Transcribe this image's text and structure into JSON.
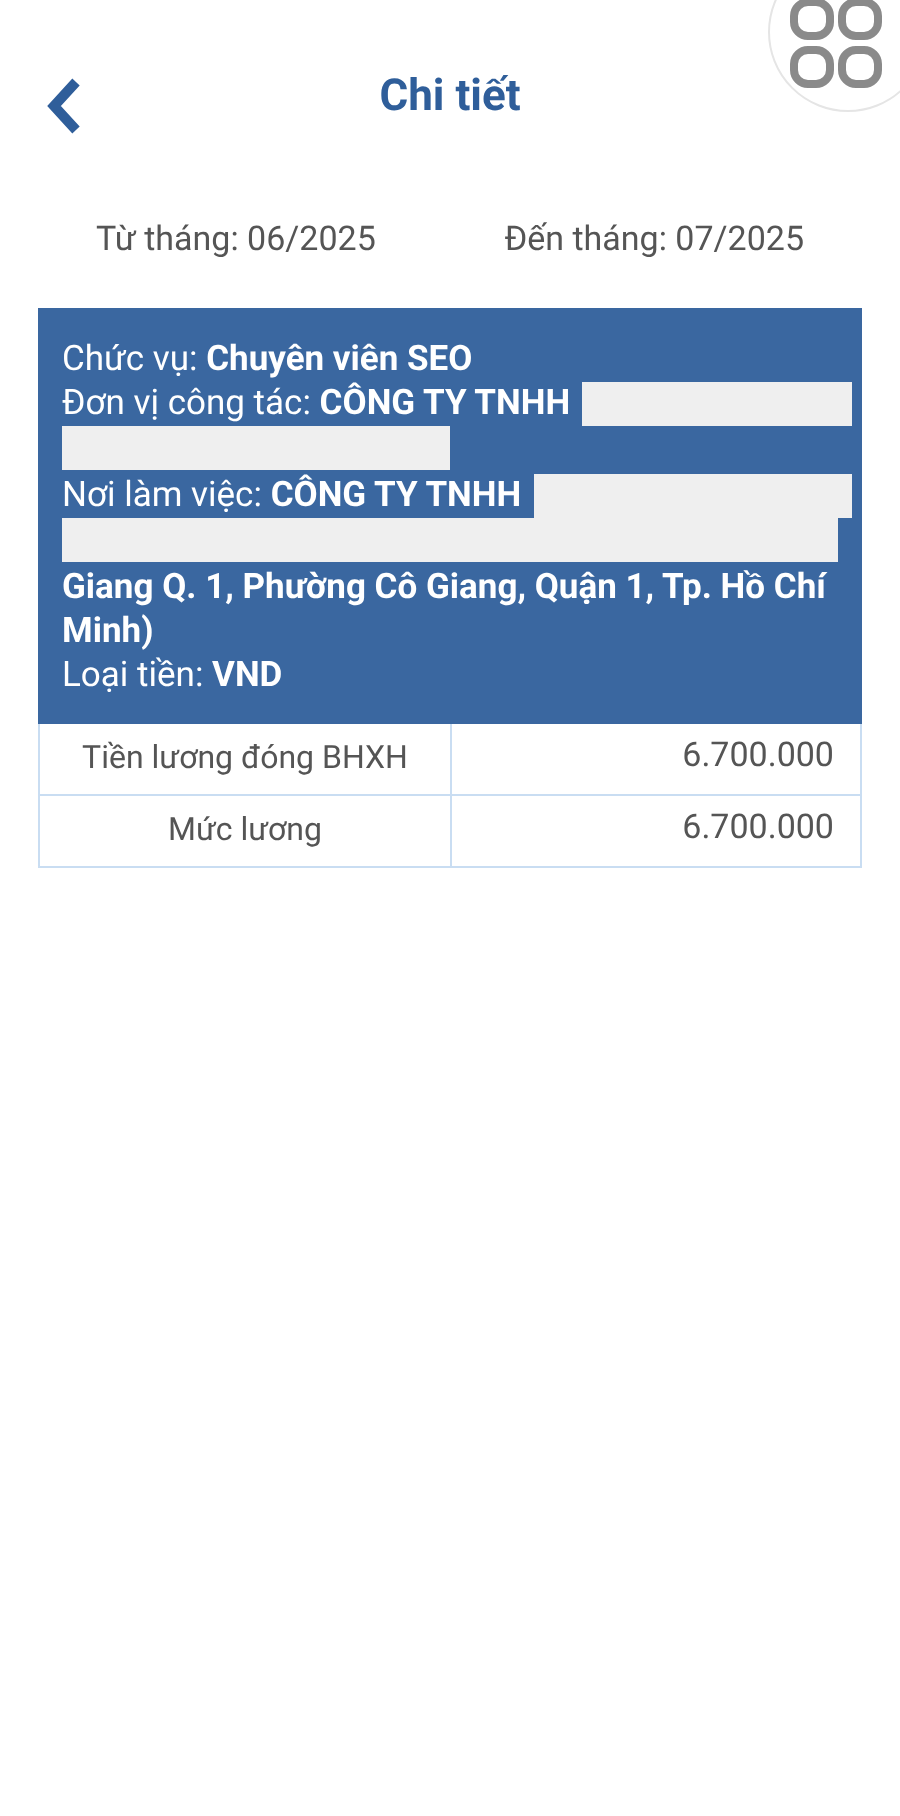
{
  "header": {
    "title": "Chi tiết"
  },
  "period": {
    "from": "Từ tháng: 06/2025",
    "to": "Đến tháng: 07/2025"
  },
  "info": [
    {
      "label": "Chức vụ:",
      "value": "Chuyên viên SEO",
      "redacted": false
    },
    {
      "label": "Đơn vị công tác:",
      "value": "CÔNG TY TNHH",
      "redacted": true,
      "full_width_redaction": false
    },
    {
      "label": "Nơi làm việc:",
      "value": "CÔNG TY TNHH",
      "redacted": true,
      "full_width_redaction": true,
      "continuation": "Giang Q. 1, Phường Cô Giang, Quận 1, Tp. Hồ Chí Minh)"
    },
    {
      "label": "Loại tiền:",
      "value": "VND",
      "redacted": false
    }
  ],
  "table": {
    "rows": [
      {
        "label": "Tiền lương đóng BHXH",
        "amount": "6.700.000"
      },
      {
        "label": "Mức lương",
        "amount": "6.700.000"
      }
    ]
  }
}
